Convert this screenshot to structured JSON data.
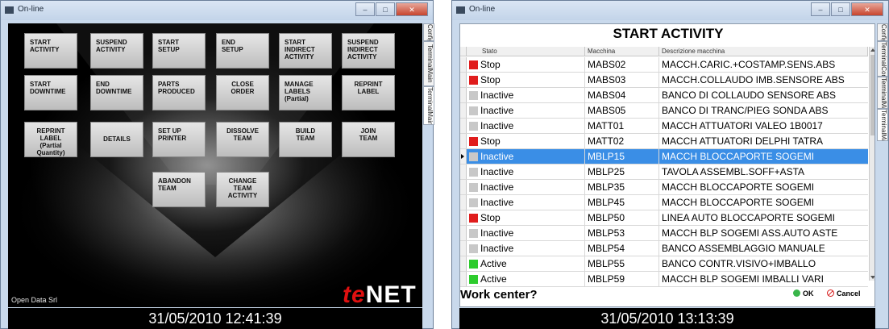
{
  "left_window": {
    "title": "On-line",
    "tabs": [
      "Config",
      "TerminalMain",
      "TerminalMain"
    ],
    "buttons": [
      "START\nACTIVITY",
      "SUSPEND\nACTIVITY",
      "START\nSETUP",
      "END\nSETUP",
      "START\nINDIRECT\nACTIVITY",
      "SUSPEND\nINDIRECT\nACTIVITY",
      "START\nDOWNTIME",
      "END\nDOWNTIME",
      "PARTS\nPRODUCED",
      "CLOSE\nORDER",
      "MANAGE\nLABELS\n(Partial)",
      "REPRINT\nLABEL",
      "REPRINT\nLABEL\n(Partial Quantity)",
      "DETAILS",
      "SET UP\nPRINTER",
      "DISSOLVE\nTEAM",
      "BUILD\nTEAM",
      "JOIN\nTEAM",
      "ABANDON\nTEAM",
      "CHANGE\nTEAM\nACTIVITY"
    ],
    "company": "Open Data Srl",
    "logo_te": "te",
    "logo_net": "NET",
    "clock": "31/05/2010 12:41:39"
  },
  "right_window": {
    "title": "On-line",
    "tabs": [
      "Config",
      "TerminalConfig",
      "TerminalMain",
      "TerminalMain"
    ],
    "heading": "START ACTIVITY",
    "columns": [
      "Stato",
      "Macchina",
      "Descrizione macchina"
    ],
    "rows": [
      {
        "status": "Stop",
        "color": "#e01d1d",
        "machine": "MABS02",
        "description": "MACCH.CARIC.+COSTAMP.SENS.ABS"
      },
      {
        "status": "Stop",
        "color": "#e01d1d",
        "machine": "MABS03",
        "description": "MACCH.COLLAUDO IMB.SENSORE ABS"
      },
      {
        "status": "Inactive",
        "color": "#c8c8c8",
        "machine": "MABS04",
        "description": "BANCO DI COLLAUDO SENSORE ABS"
      },
      {
        "status": "Inactive",
        "color": "#c8c8c8",
        "machine": "MABS05",
        "description": "BANCO DI TRANC/PIEG SONDA ABS"
      },
      {
        "status": "Inactive",
        "color": "#c8c8c8",
        "machine": "MATT01",
        "description": "MACCH ATTUATORI VALEO 1B0017"
      },
      {
        "status": "Stop",
        "color": "#e01d1d",
        "machine": "MATT02",
        "description": "MACCH ATTUATORI DELPHI TATRA"
      },
      {
        "status": "Inactive",
        "color": "#c8c8c8",
        "machine": "MBLP15",
        "description": "MACCH BLOCCAPORTE SOGEMI",
        "selected": true
      },
      {
        "status": "Inactive",
        "color": "#c8c8c8",
        "machine": "MBLP25",
        "description": "TAVOLA ASSEMBL.SOFF+ASTA"
      },
      {
        "status": "Inactive",
        "color": "#c8c8c8",
        "machine": "MBLP35",
        "description": "MACCH BLOCCAPORTE SOGEMI"
      },
      {
        "status": "Inactive",
        "color": "#c8c8c8",
        "machine": "MBLP45",
        "description": "MACCH BLOCCAPORTE SOGEMI"
      },
      {
        "status": "Stop",
        "color": "#e01d1d",
        "machine": "MBLP50",
        "description": "LINEA AUTO BLOCCAPORTE SOGEMI"
      },
      {
        "status": "Inactive",
        "color": "#c8c8c8",
        "machine": "MBLP53",
        "description": "MACCH BLP SOGEMI ASS.AUTO ASTE"
      },
      {
        "status": "Inactive",
        "color": "#c8c8c8",
        "machine": "MBLP54",
        "description": "BANCO ASSEMBLAGGIO MANUALE"
      },
      {
        "status": "Active",
        "color": "#2ecc2e",
        "machine": "MBLP55",
        "description": "BANCO CONTR.VISIVO+IMBALLO"
      },
      {
        "status": "Active",
        "color": "#2ecc2e",
        "machine": "MBLP59",
        "description": "MACCH BLP SOGEMI IMBALLI VARI"
      }
    ],
    "prompt": "Work center?",
    "ok_label": "OK",
    "cancel_label": "Cancel",
    "clock": "31/05/2010 13:13:39"
  }
}
